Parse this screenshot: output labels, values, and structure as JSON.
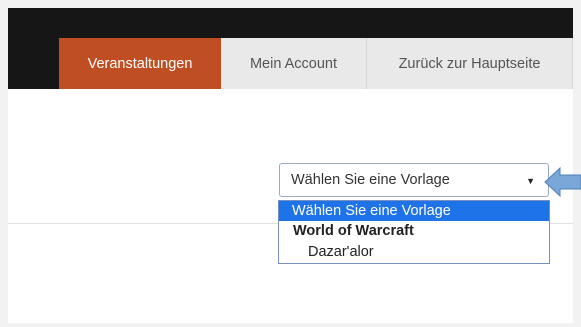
{
  "nav": {
    "tabs": [
      {
        "label": "Veranstaltungen",
        "active": true
      },
      {
        "label": "Mein Account",
        "active": false
      },
      {
        "label": "Zurück zur Hauptseite",
        "active": false
      }
    ]
  },
  "template_select": {
    "selected_value": "Wählen Sie eine Vorlage",
    "options": [
      {
        "label": "Wählen Sie eine Vorlage",
        "highlighted": true
      },
      {
        "group_label": "World of Warcraft"
      },
      {
        "label": "Dazar'alor"
      }
    ]
  },
  "icons": {
    "dropdown_arrow": "triangle-down-icon",
    "pointer": "arrow-left-icon"
  },
  "colors": {
    "active_tab": "#bf4e22",
    "nav_bg": "#161616",
    "highlight": "#1e73e8",
    "pointer_arrow": "#7aa7d8"
  }
}
